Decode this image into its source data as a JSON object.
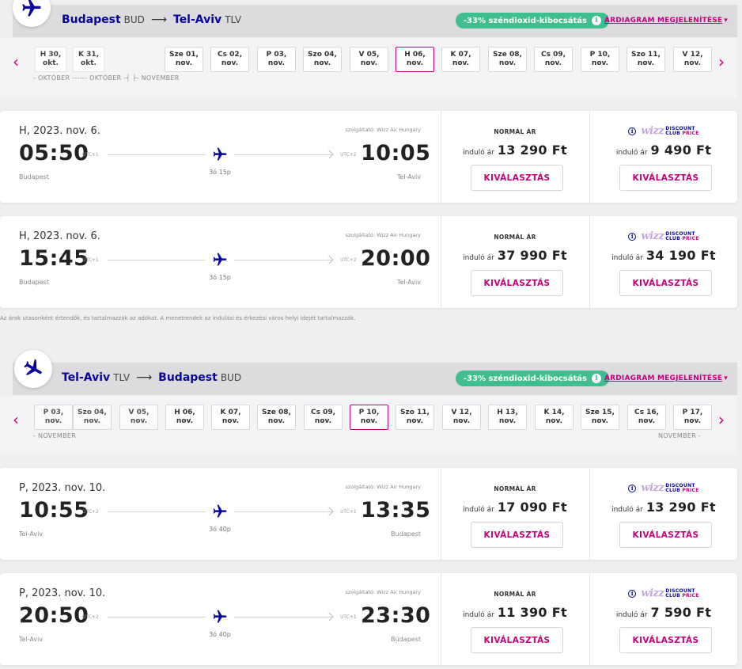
{
  "brand": {
    "accent": "#c6007e",
    "navy": "#06049d",
    "green": "#3fbf8f"
  },
  "common": {
    "co2_label": "-33% széndioxid-kibocsátás",
    "price_diagram_label": "ÁRDIAGRAM MEGJELENÍTÉSE",
    "normal_fare_title": "NORMÁL ÁR",
    "discount_club_wordmark": "wizz",
    "discount_club_line1": "DISCOUNT",
    "discount_club_line2a": "CLUB ",
    "discount_club_line2b": "PRICE",
    "from_label": "induló ár",
    "select_label": "KIVÁLASZTÁS",
    "operator_label": "szolgáltató: Wizz Air Hungary",
    "disclaimer": "Az árak utasonként értendők, és tartalmazzák az adókat. A menetrendek az indulási és érkezési város helyi idejét tartalmazzák."
  },
  "outbound": {
    "from_city": "Budapest",
    "from_code": "BUD",
    "to_city": "Tel-Aviv",
    "to_code": "TLV",
    "arrow": "⟶",
    "dates": [
      {
        "line1": "H 30,",
        "line2": "okt."
      },
      {
        "line1": "K 31,",
        "line2": "okt."
      },
      {
        "line1": "Sze 01,",
        "line2": "nov."
      },
      {
        "line1": "Cs 02,",
        "line2": "nov."
      },
      {
        "line1": "P 03,",
        "line2": "nov."
      },
      {
        "line1": "Szo 04,",
        "line2": "nov."
      },
      {
        "line1": "V 05,",
        "line2": "nov."
      },
      {
        "line1": "H 06,",
        "line2": "nov.",
        "selected": true
      },
      {
        "line1": "K 07,",
        "line2": "nov."
      },
      {
        "line1": "Sze 08,",
        "line2": "nov."
      },
      {
        "line1": "Cs 09,",
        "line2": "nov."
      },
      {
        "line1": "P 10,",
        "line2": "nov."
      },
      {
        "line1": "Szo 11,",
        "line2": "nov."
      },
      {
        "line1": "V 12,",
        "line2": "nov."
      }
    ],
    "months": {
      "left": "- OKTÓBER ------ OKTÓBER -┤ ├- NOVEMBER"
    },
    "flights": [
      {
        "date": "H, 2023. nov. 6.",
        "dep_time": "05:50",
        "dep_utc": "UTC+1",
        "arr_time": "10:05",
        "arr_utc": "UTC+2",
        "duration": "3ó 15p",
        "dep_city": "Budapest",
        "arr_city": "Tel-Aviv",
        "normal_price": "13 290 Ft",
        "club_price": "9 490 Ft"
      },
      {
        "date": "H, 2023. nov. 6.",
        "dep_time": "15:45",
        "dep_utc": "UTC+1",
        "arr_time": "20:00",
        "arr_utc": "UTC+2",
        "duration": "3ó 15p",
        "dep_city": "Budapest",
        "arr_city": "Tel-Aviv",
        "normal_price": "37 990 Ft",
        "club_price": "34 190 Ft"
      }
    ]
  },
  "return": {
    "from_city": "Tel-Aviv",
    "from_code": "TLV",
    "to_city": "Budapest",
    "to_code": "BUD",
    "arrow": "⟶",
    "dates": [
      {
        "line1": "P 03,",
        "line2": "nov.",
        "disabled": true
      },
      {
        "line1": "Szo 04,",
        "line2": "nov.",
        "disabled": true
      },
      {
        "line1": "V 05,",
        "line2": "nov.",
        "disabled": true
      },
      {
        "line1": "H 06,",
        "line2": "nov."
      },
      {
        "line1": "K 07,",
        "line2": "nov."
      },
      {
        "line1": "Sze 08,",
        "line2": "nov."
      },
      {
        "line1": "Cs 09,",
        "line2": "nov."
      },
      {
        "line1": "P 10,",
        "line2": "nov.",
        "selected": true
      },
      {
        "line1": "Szo 11,",
        "line2": "nov."
      },
      {
        "line1": "V 12,",
        "line2": "nov."
      },
      {
        "line1": "H 13,",
        "line2": "nov."
      },
      {
        "line1": "K 14,",
        "line2": "nov."
      },
      {
        "line1": "Sze 15,",
        "line2": "nov."
      },
      {
        "line1": "Cs 16,",
        "line2": "nov."
      },
      {
        "line1": "P 17,",
        "line2": "nov."
      }
    ],
    "months": {
      "left": "- NOVEMBER",
      "right": "NOVEMBER -"
    },
    "flights": [
      {
        "date": "P, 2023. nov. 10.",
        "dep_time": "10:55",
        "dep_utc": "UTC+2",
        "arr_time": "13:35",
        "arr_utc": "UTC+1",
        "duration": "3ó 40p",
        "dep_city": "Tel-Aviv",
        "arr_city": "Budapest",
        "normal_price": "17 090 Ft",
        "club_price": "13 290 Ft"
      },
      {
        "date": "P, 2023. nov. 10.",
        "dep_time": "20:50",
        "dep_utc": "UTC+2",
        "arr_time": "23:30",
        "arr_utc": "UTC+1",
        "duration": "3ó 40p",
        "dep_city": "Tel-Aviv",
        "arr_city": "Budapest",
        "normal_price": "11 390 Ft",
        "club_price": "7 590 Ft"
      }
    ]
  }
}
